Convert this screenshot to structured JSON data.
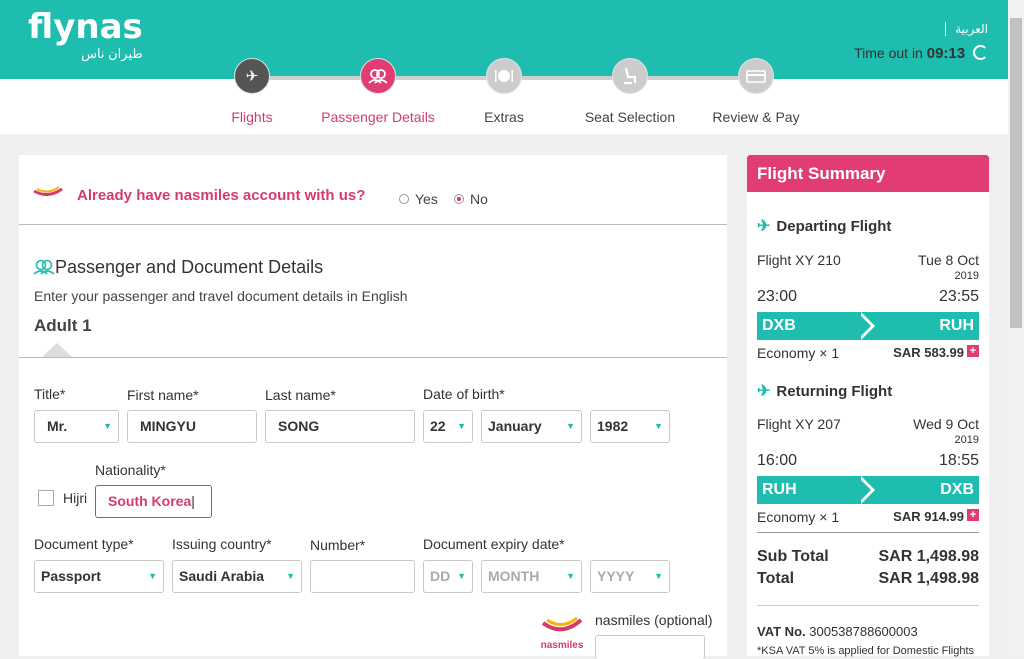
{
  "header": {
    "logo_text": "flynas",
    "logo_arabic": "طيران ناس",
    "language": "العربية",
    "timeout_label": "Time out in",
    "timeout_value": "09:13"
  },
  "steps": [
    {
      "label": "Flights",
      "state": "done",
      "icon": "plane-icon"
    },
    {
      "label": "Passenger Details",
      "state": "active",
      "icon": "passengers-icon"
    },
    {
      "label": "Extras",
      "state": "todo",
      "icon": "meal-icon"
    },
    {
      "label": "Seat Selection",
      "state": "todo",
      "icon": "seat-icon"
    },
    {
      "label": "Review & Pay",
      "state": "todo",
      "icon": "payment-icon"
    }
  ],
  "account": {
    "question": "Already have nasmiles account with us?",
    "yes": "Yes",
    "no": "No",
    "selected": "No"
  },
  "section": {
    "title": "Passenger and Document Details",
    "subtitle": "Enter your passenger and travel document details in English",
    "adult": "Adult 1"
  },
  "form": {
    "title_label": "Title*",
    "title_value": "Mr.",
    "first_label": "First name*",
    "first_value": "MINGYU",
    "last_label": "Last name*",
    "last_value": "SONG",
    "dob_label": "Date of birth*",
    "dob_day": "22",
    "dob_month": "January",
    "dob_year": "1982",
    "hijri_label": "Hijri",
    "nationality_label": "Nationality*",
    "nationality_value": "South Korea",
    "doctype_label": "Document type*",
    "doctype_value": "Passport",
    "issuing_label": "Issuing country*",
    "issuing_value": "Saudi Arabia",
    "number_label": "Number*",
    "number_value": "",
    "expiry_label": "Document expiry date*",
    "expiry_day_ph": "DD",
    "expiry_month_ph": "MONTH",
    "expiry_year_ph": "YYYY",
    "nasmiles_label": "nasmiles (optional)",
    "nasmiles_logo": "nasmiles"
  },
  "summary": {
    "title": "Flight Summary",
    "departing": {
      "title": "Departing Flight",
      "flight": "Flight XY 210",
      "date": "Tue 8 Oct",
      "year": "2019",
      "dep_time": "23:00",
      "arr_time": "23:55",
      "from": "DXB",
      "to": "RUH",
      "class": "Economy × 1",
      "price": "SAR 583.99"
    },
    "returning": {
      "title": "Returning Flight",
      "flight": "Flight XY 207",
      "date": "Wed 9 Oct",
      "year": "2019",
      "dep_time": "16:00",
      "arr_time": "18:55",
      "from": "RUH",
      "to": "DXB",
      "class": "Economy × 1",
      "price": "SAR 914.99"
    },
    "subtotal_label": "Sub Total",
    "subtotal_value": "SAR 1,498.98",
    "total_label": "Total",
    "total_value": "SAR 1,498.98",
    "vat_label": "VAT No.",
    "vat_value": "300538788600003",
    "vat_note": "*KSA VAT 5% is applied for Domestic Flights"
  },
  "colors": {
    "teal": "#1ebdb0",
    "pink": "#e13c73"
  }
}
